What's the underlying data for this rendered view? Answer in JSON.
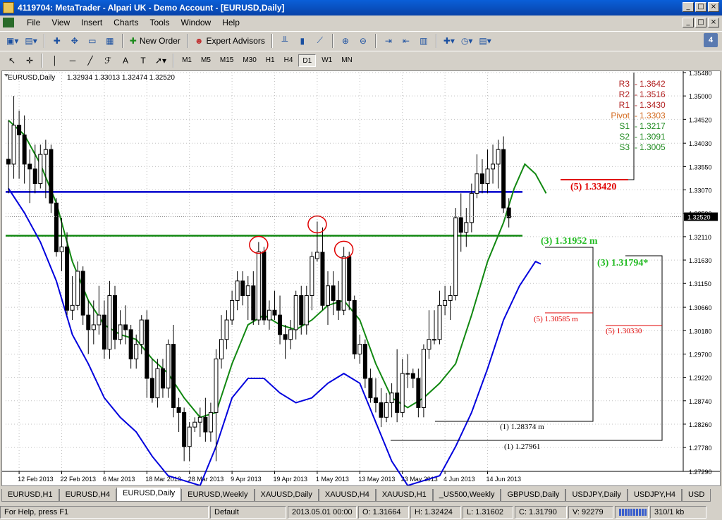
{
  "window": {
    "title": "4119704: MetaTrader - Alpari UK - Demo Account - [EURUSD,Daily]",
    "controls": [
      "_",
      "□",
      "×"
    ]
  },
  "menu": [
    "File",
    "View",
    "Insert",
    "Charts",
    "Tools",
    "Window",
    "Help"
  ],
  "toolbar": {
    "new_order": "New Order",
    "expert_advisors": "Expert Advisors",
    "timeframes": [
      "M1",
      "M5",
      "M15",
      "M30",
      "H1",
      "H4",
      "D1",
      "W1",
      "MN"
    ],
    "active_timeframe": "D1",
    "help_badge": "4"
  },
  "chart_data": {
    "type": "candlestick",
    "symbol_label": "EURUSD,Daily",
    "ohlc_header": "1.32934 1.33013 1.32474 1.32520",
    "current_price": "1.32520",
    "ylim": [
      1.2729,
      1.3548
    ],
    "x_range": [
      "2013-02-08",
      "2013-06-27"
    ],
    "price_ticks": [
      "1.35480",
      "1.35000",
      "1.34520",
      "1.34030",
      "1.33550",
      "1.33070",
      "1.32590",
      "1.32110",
      "1.31630",
      "1.31150",
      "1.30660",
      "1.30180",
      "1.29700",
      "1.29220",
      "1.28740",
      "1.28260",
      "1.27780",
      "1.27290"
    ],
    "date_ticks": [
      "12 Feb 2013",
      "22 Feb 2013",
      "6 Mar 2013",
      "18 Mar 2013",
      "28 Mar 2013",
      "9 Apr 2013",
      "19 Apr 2013",
      "1 May 2013",
      "13 May 2013",
      "23 May 2013",
      "4 Jun 2013",
      "14 Jun 2013"
    ],
    "pivot_labels": [
      {
        "label": "R3",
        "value": "1.3642",
        "color": "#b22222"
      },
      {
        "label": "R2",
        "value": "1.3516",
        "color": "#b22222"
      },
      {
        "label": "R1",
        "value": "1.3430",
        "color": "#b22222"
      },
      {
        "label": "Pivot",
        "value": "1.3303",
        "color": "#d2691e"
      },
      {
        "label": "S1",
        "value": "1.3217",
        "color": "#228b22"
      },
      {
        "label": "S2",
        "value": "1.3091",
        "color": "#228b22"
      },
      {
        "label": "S3",
        "value": "1.3005",
        "color": "#228b22"
      }
    ],
    "annotations": [
      {
        "text": "(5) 1.33420",
        "color": "#e00000",
        "bold": true
      },
      {
        "text": "(3) 1.31952  m",
        "color": "#22bb22",
        "bold": true
      },
      {
        "text": "(3) 1.31794*",
        "color": "#22bb22",
        "bold": true
      },
      {
        "text": "(5) 1.30585  m",
        "color": "#e00000",
        "bold": false
      },
      {
        "text": "(5) 1.30330",
        "color": "#e00000",
        "bold": false
      },
      {
        "text": "(1) 1.28374  m",
        "color": "#000000",
        "bold": false
      },
      {
        "text": "(1) 1.27961",
        "color": "#000000",
        "bold": false
      }
    ],
    "horizontal_levels": [
      {
        "price": 1.3303,
        "color": "#0000cc"
      },
      {
        "price": 1.3213,
        "color": "#118811"
      }
    ],
    "colors": {
      "bull": "#ffffff",
      "bear": "#000000",
      "ma_green": "#118811",
      "band_blue": "#0000dd",
      "circle": "#e00000"
    },
    "candles": [
      {
        "d": "2013-02-08",
        "o": 1.337,
        "h": 1.345,
        "l": 1.33,
        "c": 1.336
      },
      {
        "d": "2013-02-11",
        "o": 1.336,
        "h": 1.35,
        "l": 1.333,
        "c": 1.344
      },
      {
        "d": "2013-02-12",
        "o": 1.344,
        "h": 1.347,
        "l": 1.333,
        "c": 1.342
      },
      {
        "d": "2013-02-13",
        "o": 1.342,
        "h": 1.346,
        "l": 1.332,
        "c": 1.336
      },
      {
        "d": "2013-02-14",
        "o": 1.336,
        "h": 1.339,
        "l": 1.328,
        "c": 1.335
      },
      {
        "d": "2013-02-15",
        "o": 1.335,
        "h": 1.34,
        "l": 1.33,
        "c": 1.332
      },
      {
        "d": "2013-02-18",
        "o": 1.332,
        "h": 1.34,
        "l": 1.331,
        "c": 1.338
      },
      {
        "d": "2013-02-19",
        "o": 1.338,
        "h": 1.341,
        "l": 1.329,
        "c": 1.339
      },
      {
        "d": "2013-02-20",
        "o": 1.339,
        "h": 1.34,
        "l": 1.326,
        "c": 1.328
      },
      {
        "d": "2013-02-21",
        "o": 1.328,
        "h": 1.329,
        "l": 1.317,
        "c": 1.318
      },
      {
        "d": "2013-02-22",
        "o": 1.318,
        "h": 1.325,
        "l": 1.314,
        "c": 1.319
      },
      {
        "d": "2013-02-25",
        "o": 1.319,
        "h": 1.322,
        "l": 1.305,
        "c": 1.306
      },
      {
        "d": "2013-02-26",
        "o": 1.306,
        "h": 1.313,
        "l": 1.304,
        "c": 1.307
      },
      {
        "d": "2013-02-27",
        "o": 1.307,
        "h": 1.316,
        "l": 1.306,
        "c": 1.314
      },
      {
        "d": "2013-02-28",
        "o": 1.314,
        "h": 1.315,
        "l": 1.303,
        "c": 1.305
      },
      {
        "d": "2013-03-01",
        "o": 1.305,
        "h": 1.308,
        "l": 1.297,
        "c": 1.302
      },
      {
        "d": "2013-03-04",
        "o": 1.302,
        "h": 1.308,
        "l": 1.299,
        "c": 1.303
      },
      {
        "d": "2013-03-05",
        "o": 1.303,
        "h": 1.311,
        "l": 1.301,
        "c": 1.305
      },
      {
        "d": "2013-03-06",
        "o": 1.305,
        "h": 1.308,
        "l": 1.296,
        "c": 1.298
      },
      {
        "d": "2013-03-07",
        "o": 1.298,
        "h": 1.312,
        "l": 1.296,
        "c": 1.309
      },
      {
        "d": "2013-03-08",
        "o": 1.309,
        "h": 1.311,
        "l": 1.298,
        "c": 1.3
      },
      {
        "d": "2013-03-11",
        "o": 1.3,
        "h": 1.306,
        "l": 1.299,
        "c": 1.303
      },
      {
        "d": "2013-03-12",
        "o": 1.303,
        "h": 1.307,
        "l": 1.299,
        "c": 1.302
      },
      {
        "d": "2013-03-13",
        "o": 1.302,
        "h": 1.303,
        "l": 1.294,
        "c": 1.296
      },
      {
        "d": "2013-03-14",
        "o": 1.296,
        "h": 1.301,
        "l": 1.294,
        "c": 1.299
      },
      {
        "d": "2013-03-15",
        "o": 1.299,
        "h": 1.305,
        "l": 1.297,
        "c": 1.304
      },
      {
        "d": "2013-03-18",
        "o": 1.304,
        "h": 1.306,
        "l": 1.288,
        "c": 1.292
      },
      {
        "d": "2013-03-19",
        "o": 1.292,
        "h": 1.296,
        "l": 1.287,
        "c": 1.288
      },
      {
        "d": "2013-03-20",
        "o": 1.288,
        "h": 1.296,
        "l": 1.286,
        "c": 1.294
      },
      {
        "d": "2013-03-21",
        "o": 1.294,
        "h": 1.296,
        "l": 1.288,
        "c": 1.29
      },
      {
        "d": "2013-03-22",
        "o": 1.29,
        "h": 1.3,
        "l": 1.288,
        "c": 1.299
      },
      {
        "d": "2013-03-25",
        "o": 1.299,
        "h": 1.303,
        "l": 1.284,
        "c": 1.286
      },
      {
        "d": "2013-03-26",
        "o": 1.286,
        "h": 1.288,
        "l": 1.281,
        "c": 1.285
      },
      {
        "d": "2013-03-27",
        "o": 1.285,
        "h": 1.286,
        "l": 1.275,
        "c": 1.278
      },
      {
        "d": "2013-03-28",
        "o": 1.278,
        "h": 1.283,
        "l": 1.275,
        "c": 1.282
      },
      {
        "d": "2013-03-29",
        "o": 1.282,
        "h": 1.284,
        "l": 1.281,
        "c": 1.283
      },
      {
        "d": "2013-04-01",
        "o": 1.283,
        "h": 1.286,
        "l": 1.28,
        "c": 1.284
      },
      {
        "d": "2013-04-02",
        "o": 1.284,
        "h": 1.288,
        "l": 1.279,
        "c": 1.281
      },
      {
        "d": "2013-04-03",
        "o": 1.281,
        "h": 1.287,
        "l": 1.279,
        "c": 1.285
      },
      {
        "d": "2013-04-04",
        "o": 1.285,
        "h": 1.298,
        "l": 1.275,
        "c": 1.296
      },
      {
        "d": "2013-04-05",
        "o": 1.296,
        "h": 1.305,
        "l": 1.294,
        "c": 1.3
      },
      {
        "d": "2013-04-08",
        "o": 1.3,
        "h": 1.306,
        "l": 1.298,
        "c": 1.304
      },
      {
        "d": "2013-04-09",
        "o": 1.304,
        "h": 1.31,
        "l": 1.303,
        "c": 1.308
      },
      {
        "d": "2013-04-10",
        "o": 1.308,
        "h": 1.314,
        "l": 1.306,
        "c": 1.312
      },
      {
        "d": "2013-04-11",
        "o": 1.312,
        "h": 1.314,
        "l": 1.307,
        "c": 1.309
      },
      {
        "d": "2013-04-12",
        "o": 1.309,
        "h": 1.313,
        "l": 1.304,
        "c": 1.311
      },
      {
        "d": "2013-04-15",
        "o": 1.311,
        "h": 1.314,
        "l": 1.303,
        "c": 1.304
      },
      {
        "d": "2013-04-16",
        "o": 1.304,
        "h": 1.32,
        "l": 1.303,
        "c": 1.318
      },
      {
        "d": "2013-04-17",
        "o": 1.318,
        "h": 1.319,
        "l": 1.303,
        "c": 1.304
      },
      {
        "d": "2013-04-18",
        "o": 1.304,
        "h": 1.308,
        "l": 1.302,
        "c": 1.306
      },
      {
        "d": "2013-04-19",
        "o": 1.306,
        "h": 1.31,
        "l": 1.304,
        "c": 1.305
      },
      {
        "d": "2013-04-22",
        "o": 1.305,
        "h": 1.309,
        "l": 1.299,
        "c": 1.301
      },
      {
        "d": "2013-04-23",
        "o": 1.301,
        "h": 1.303,
        "l": 1.296,
        "c": 1.3
      },
      {
        "d": "2013-04-24",
        "o": 1.3,
        "h": 1.304,
        "l": 1.298,
        "c": 1.302
      },
      {
        "d": "2013-04-25",
        "o": 1.302,
        "h": 1.31,
        "l": 1.3,
        "c": 1.309
      },
      {
        "d": "2013-04-26",
        "o": 1.309,
        "h": 1.311,
        "l": 1.301,
        "c": 1.303
      },
      {
        "d": "2013-04-29",
        "o": 1.303,
        "h": 1.311,
        "l": 1.301,
        "c": 1.309
      },
      {
        "d": "2013-04-30",
        "o": 1.309,
        "h": 1.318,
        "l": 1.306,
        "c": 1.317
      },
      {
        "d": "2013-05-01",
        "o": 1.3166,
        "h": 1.3242,
        "l": 1.316,
        "c": 1.3179
      },
      {
        "d": "2013-05-02",
        "o": 1.3179,
        "h": 1.323,
        "l": 1.306,
        "c": 1.307
      },
      {
        "d": "2013-05-03",
        "o": 1.307,
        "h": 1.314,
        "l": 1.303,
        "c": 1.311
      },
      {
        "d": "2013-05-06",
        "o": 1.311,
        "h": 1.314,
        "l": 1.305,
        "c": 1.308
      },
      {
        "d": "2013-05-07",
        "o": 1.308,
        "h": 1.312,
        "l": 1.304,
        "c": 1.306
      },
      {
        "d": "2013-05-08",
        "o": 1.306,
        "h": 1.319,
        "l": 1.305,
        "c": 1.317
      },
      {
        "d": "2013-05-09",
        "o": 1.317,
        "h": 1.318,
        "l": 1.306,
        "c": 1.308
      },
      {
        "d": "2013-05-10",
        "o": 1.308,
        "h": 1.309,
        "l": 1.296,
        "c": 1.297
      },
      {
        "d": "2013-05-13",
        "o": 1.297,
        "h": 1.301,
        "l": 1.295,
        "c": 1.299
      },
      {
        "d": "2013-05-14",
        "o": 1.299,
        "h": 1.3,
        "l": 1.29,
        "c": 1.292
      },
      {
        "d": "2013-05-15",
        "o": 1.292,
        "h": 1.294,
        "l": 1.287,
        "c": 1.288
      },
      {
        "d": "2013-05-16",
        "o": 1.288,
        "h": 1.292,
        "l": 1.285,
        "c": 1.287
      },
      {
        "d": "2013-05-17",
        "o": 1.287,
        "h": 1.29,
        "l": 1.282,
        "c": 1.284
      },
      {
        "d": "2013-05-20",
        "o": 1.284,
        "h": 1.289,
        "l": 1.283,
        "c": 1.287
      },
      {
        "d": "2013-05-21",
        "o": 1.287,
        "h": 1.291,
        "l": 1.284,
        "c": 1.289
      },
      {
        "d": "2013-05-22",
        "o": 1.289,
        "h": 1.298,
        "l": 1.283,
        "c": 1.285
      },
      {
        "d": "2013-05-23",
        "o": 1.285,
        "h": 1.296,
        "l": 1.284,
        "c": 1.293
      },
      {
        "d": "2013-05-24",
        "o": 1.293,
        "h": 1.297,
        "l": 1.29,
        "c": 1.293
      },
      {
        "d": "2013-05-27",
        "o": 1.293,
        "h": 1.294,
        "l": 1.29,
        "c": 1.292
      },
      {
        "d": "2013-05-28",
        "o": 1.292,
        "h": 1.294,
        "l": 1.284,
        "c": 1.286
      },
      {
        "d": "2013-05-29",
        "o": 1.286,
        "h": 1.299,
        "l": 1.284,
        "c": 1.298
      },
      {
        "d": "2013-05-30",
        "o": 1.298,
        "h": 1.306,
        "l": 1.296,
        "c": 1.3
      },
      {
        "d": "2013-05-31",
        "o": 1.3,
        "h": 1.306,
        "l": 1.299,
        "c": 1.3
      },
      {
        "d": "2013-06-03",
        "o": 1.3,
        "h": 1.31,
        "l": 1.299,
        "c": 1.307
      },
      {
        "d": "2013-06-04",
        "o": 1.307,
        "h": 1.311,
        "l": 1.305,
        "c": 1.308
      },
      {
        "d": "2013-06-05",
        "o": 1.308,
        "h": 1.311,
        "l": 1.304,
        "c": 1.309
      },
      {
        "d": "2013-06-06",
        "o": 1.309,
        "h": 1.327,
        "l": 1.308,
        "c": 1.325
      },
      {
        "d": "2013-06-07",
        "o": 1.325,
        "h": 1.33,
        "l": 1.318,
        "c": 1.322
      },
      {
        "d": "2013-06-10",
        "o": 1.322,
        "h": 1.327,
        "l": 1.319,
        "c": 1.324
      },
      {
        "d": "2013-06-11",
        "o": 1.324,
        "h": 1.332,
        "l": 1.322,
        "c": 1.33
      },
      {
        "d": "2013-06-12",
        "o": 1.33,
        "h": 1.338,
        "l": 1.329,
        "c": 1.334
      },
      {
        "d": "2013-06-13",
        "o": 1.334,
        "h": 1.337,
        "l": 1.33,
        "c": 1.332
      },
      {
        "d": "2013-06-14",
        "o": 1.332,
        "h": 1.339,
        "l": 1.33,
        "c": 1.335
      },
      {
        "d": "2013-06-17",
        "o": 1.335,
        "h": 1.34,
        "l": 1.332,
        "c": 1.336
      },
      {
        "d": "2013-06-18",
        "o": 1.336,
        "h": 1.341,
        "l": 1.331,
        "c": 1.339
      },
      {
        "d": "2013-06-19",
        "o": 1.339,
        "h": 1.3417,
        "l": 1.326,
        "c": 1.327
      },
      {
        "d": "2013-06-20",
        "o": 1.327,
        "h": 1.329,
        "l": 1.323,
        "c": 1.325
      }
    ],
    "ma_green": [
      [
        0,
        1.345
      ],
      [
        3,
        1.342
      ],
      [
        6,
        1.336
      ],
      [
        9,
        1.328
      ],
      [
        12,
        1.316
      ],
      [
        15,
        1.308
      ],
      [
        18,
        1.303
      ],
      [
        21,
        1.301
      ],
      [
        24,
        1.3
      ],
      [
        27,
        1.296
      ],
      [
        30,
        1.293
      ],
      [
        33,
        1.288
      ],
      [
        36,
        1.284
      ],
      [
        39,
        1.285
      ],
      [
        42,
        1.295
      ],
      [
        45,
        1.303
      ],
      [
        48,
        1.305
      ],
      [
        51,
        1.303
      ],
      [
        54,
        1.302
      ],
      [
        57,
        1.304
      ],
      [
        60,
        1.307
      ],
      [
        63,
        1.308
      ],
      [
        66,
        1.304
      ],
      [
        69,
        1.295
      ],
      [
        72,
        1.288
      ],
      [
        75,
        1.286
      ],
      [
        78,
        1.288
      ],
      [
        81,
        1.291
      ],
      [
        84,
        1.295
      ],
      [
        87,
        1.305
      ],
      [
        90,
        1.316
      ],
      [
        93,
        1.324
      ],
      [
        95,
        1.331
      ],
      [
        97,
        1.336
      ],
      [
        99,
        1.334
      ],
      [
        101,
        1.33
      ]
    ],
    "band_blue": [
      [
        0,
        1.331
      ],
      [
        3,
        1.326
      ],
      [
        6,
        1.32
      ],
      [
        9,
        1.312
      ],
      [
        12,
        1.301
      ],
      [
        15,
        1.295
      ],
      [
        18,
        1.288
      ],
      [
        21,
        1.284
      ],
      [
        24,
        1.281
      ],
      [
        27,
        1.276
      ],
      [
        30,
        1.272
      ],
      [
        36,
        1.27
      ],
      [
        39,
        1.278
      ],
      [
        42,
        1.288
      ],
      [
        45,
        1.292
      ],
      [
        48,
        1.292
      ],
      [
        51,
        1.289
      ],
      [
        54,
        1.287
      ],
      [
        57,
        1.288
      ],
      [
        60,
        1.291
      ],
      [
        63,
        1.293
      ],
      [
        66,
        1.291
      ],
      [
        69,
        1.283
      ],
      [
        72,
        1.275
      ],
      [
        75,
        1.27
      ],
      [
        81,
        1.272
      ],
      [
        84,
        1.278
      ],
      [
        87,
        1.285
      ],
      [
        90,
        1.294
      ],
      [
        93,
        1.304
      ],
      [
        96,
        1.311
      ],
      [
        99,
        1.316
      ],
      [
        100,
        1.3155
      ]
    ]
  },
  "tabs": [
    "EURUSD,H1",
    "EURUSD,H4",
    "EURUSD,Daily",
    "EURUSD,Weekly",
    "XAUUSD,Daily",
    "XAUUSD,H4",
    "XAUUSD,H1",
    "_US500,Weekly",
    "GBPUSD,Daily",
    "USDJPY,Daily",
    "USDJPY,H4",
    "USD"
  ],
  "active_tab": "EURUSD,Daily",
  "status": {
    "help": "For Help, press F1",
    "profile": "Default",
    "time": "2013.05.01 00:00",
    "open": "O: 1.31664",
    "high": "H: 1.32424",
    "low": "L: 1.31602",
    "close": "C: 1.31790",
    "volume": "V: 92279",
    "traffic": "310/1 kb"
  }
}
